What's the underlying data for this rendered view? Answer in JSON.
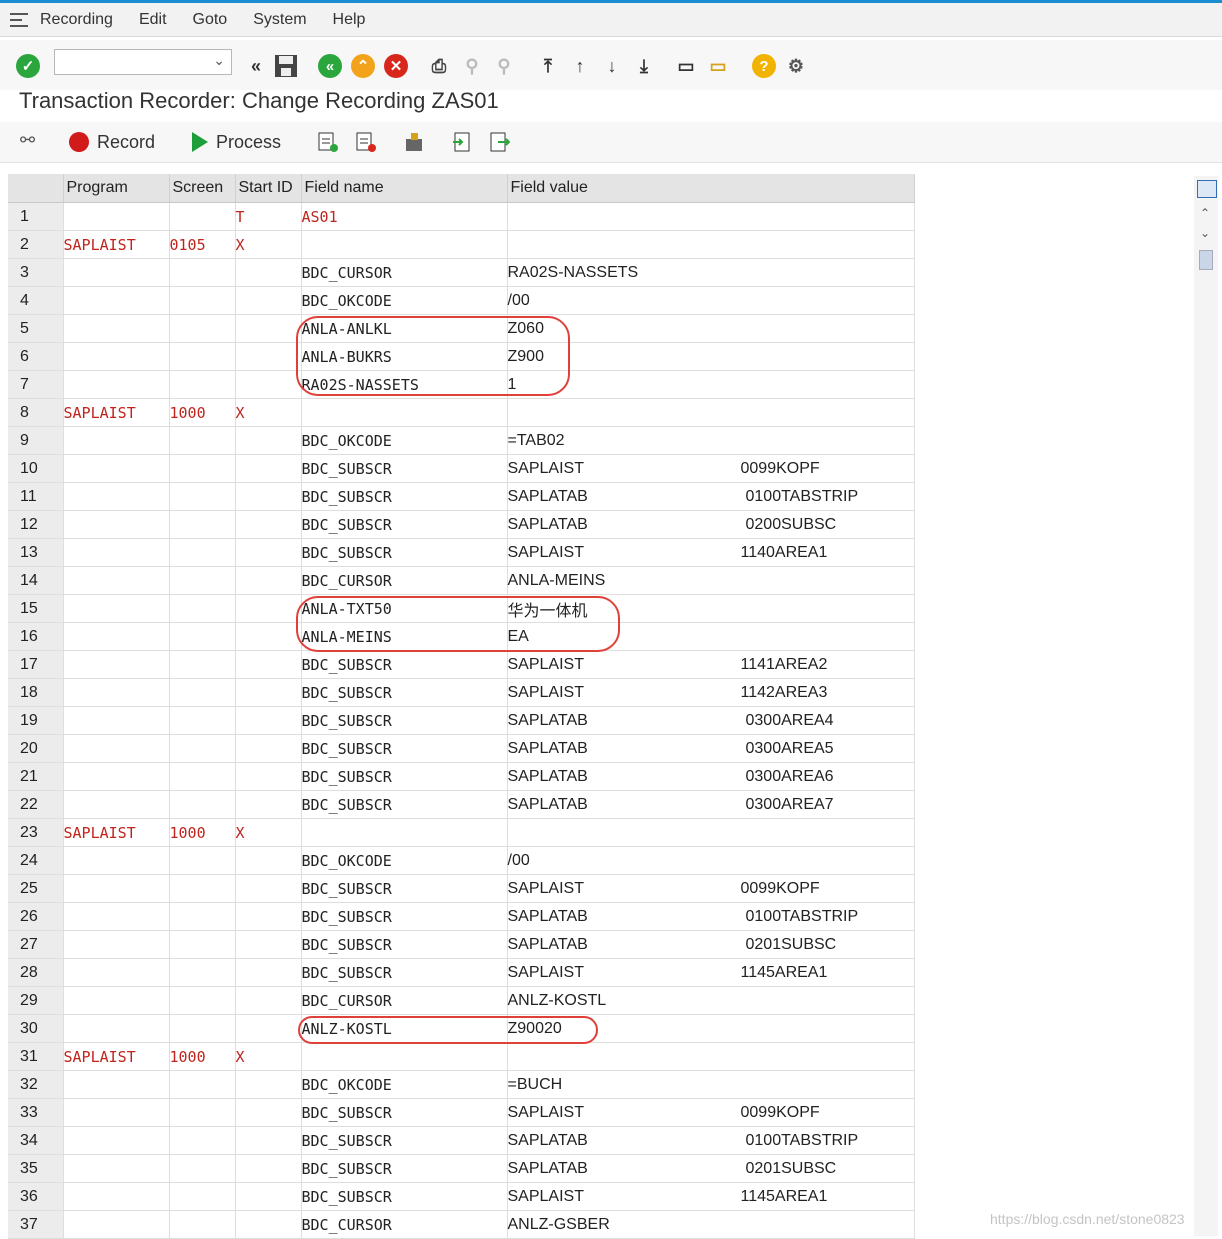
{
  "menu": [
    "Recording",
    "Edit",
    "Goto",
    "System",
    "Help"
  ],
  "page_title": "Transaction Recorder: Change Recording ZAS01",
  "app_toolbar": {
    "record_label": "Record",
    "process_label": "Process"
  },
  "columns": [
    "",
    "Program",
    "Screen",
    "Start ID",
    "Field name",
    "Field value"
  ],
  "rows": [
    {
      "n": "1",
      "program": "",
      "screen": "",
      "start": "T",
      "field": "AS01",
      "value": "",
      "extra": ""
    },
    {
      "n": "2",
      "program": "SAPLAIST",
      "screen": "0105",
      "start": "X",
      "field": "",
      "value": "",
      "extra": ""
    },
    {
      "n": "3",
      "program": "",
      "screen": "",
      "start": "",
      "field": "BDC_CURSOR",
      "value": "RA02S-NASSETS",
      "extra": ""
    },
    {
      "n": "4",
      "program": "",
      "screen": "",
      "start": "",
      "field": "BDC_OKCODE",
      "value": "/00",
      "extra": ""
    },
    {
      "n": "5",
      "program": "",
      "screen": "",
      "start": "",
      "field": "ANLA-ANLKL",
      "value": "Z060",
      "extra": ""
    },
    {
      "n": "6",
      "program": "",
      "screen": "",
      "start": "",
      "field": "ANLA-BUKRS",
      "value": "Z900",
      "extra": ""
    },
    {
      "n": "7",
      "program": "",
      "screen": "",
      "start": "",
      "field": "RA02S-NASSETS",
      "value": "1",
      "extra": ""
    },
    {
      "n": "8",
      "program": "SAPLAIST",
      "screen": "1000",
      "start": "X",
      "field": "",
      "value": "",
      "extra": ""
    },
    {
      "n": "9",
      "program": "",
      "screen": "",
      "start": "",
      "field": "BDC_OKCODE",
      "value": "=TAB02",
      "extra": ""
    },
    {
      "n": "10",
      "program": "",
      "screen": "",
      "start": "",
      "field": "BDC_SUBSCR",
      "value": "SAPLAIST",
      "extra": "0099KOPF"
    },
    {
      "n": "11",
      "program": "",
      "screen": "",
      "start": "",
      "field": "BDC_SUBSCR",
      "value": "SAPLATAB",
      "extra": "0100TABSTRIP"
    },
    {
      "n": "12",
      "program": "",
      "screen": "",
      "start": "",
      "field": "BDC_SUBSCR",
      "value": "SAPLATAB",
      "extra": "0200SUBSC"
    },
    {
      "n": "13",
      "program": "",
      "screen": "",
      "start": "",
      "field": "BDC_SUBSCR",
      "value": "SAPLAIST",
      "extra": "1140AREA1"
    },
    {
      "n": "14",
      "program": "",
      "screen": "",
      "start": "",
      "field": "BDC_CURSOR",
      "value": "ANLA-MEINS",
      "extra": ""
    },
    {
      "n": "15",
      "program": "",
      "screen": "",
      "start": "",
      "field": "ANLA-TXT50",
      "value": "华为一体机",
      "extra": ""
    },
    {
      "n": "16",
      "program": "",
      "screen": "",
      "start": "",
      "field": "ANLA-MEINS",
      "value": "EA",
      "extra": ""
    },
    {
      "n": "17",
      "program": "",
      "screen": "",
      "start": "",
      "field": "BDC_SUBSCR",
      "value": "SAPLAIST",
      "extra": "1141AREA2"
    },
    {
      "n": "18",
      "program": "",
      "screen": "",
      "start": "",
      "field": "BDC_SUBSCR",
      "value": "SAPLAIST",
      "extra": "1142AREA3"
    },
    {
      "n": "19",
      "program": "",
      "screen": "",
      "start": "",
      "field": "BDC_SUBSCR",
      "value": "SAPLATAB",
      "extra": "0300AREA4"
    },
    {
      "n": "20",
      "program": "",
      "screen": "",
      "start": "",
      "field": "BDC_SUBSCR",
      "value": "SAPLATAB",
      "extra": "0300AREA5"
    },
    {
      "n": "21",
      "program": "",
      "screen": "",
      "start": "",
      "field": "BDC_SUBSCR",
      "value": "SAPLATAB",
      "extra": "0300AREA6"
    },
    {
      "n": "22",
      "program": "",
      "screen": "",
      "start": "",
      "field": "BDC_SUBSCR",
      "value": "SAPLATAB",
      "extra": "0300AREA7"
    },
    {
      "n": "23",
      "program": "SAPLAIST",
      "screen": "1000",
      "start": "X",
      "field": "",
      "value": "",
      "extra": ""
    },
    {
      "n": "24",
      "program": "",
      "screen": "",
      "start": "",
      "field": "BDC_OKCODE",
      "value": "/00",
      "extra": ""
    },
    {
      "n": "25",
      "program": "",
      "screen": "",
      "start": "",
      "field": "BDC_SUBSCR",
      "value": "SAPLAIST",
      "extra": "0099KOPF"
    },
    {
      "n": "26",
      "program": "",
      "screen": "",
      "start": "",
      "field": "BDC_SUBSCR",
      "value": "SAPLATAB",
      "extra": "0100TABSTRIP"
    },
    {
      "n": "27",
      "program": "",
      "screen": "",
      "start": "",
      "field": "BDC_SUBSCR",
      "value": "SAPLATAB",
      "extra": "0201SUBSC"
    },
    {
      "n": "28",
      "program": "",
      "screen": "",
      "start": "",
      "field": "BDC_SUBSCR",
      "value": "SAPLAIST",
      "extra": "1145AREA1"
    },
    {
      "n": "29",
      "program": "",
      "screen": "",
      "start": "",
      "field": "BDC_CURSOR",
      "value": "ANLZ-KOSTL",
      "extra": ""
    },
    {
      "n": "30",
      "program": "",
      "screen": "",
      "start": "",
      "field": "ANLZ-KOSTL",
      "value": "Z90020",
      "extra": ""
    },
    {
      "n": "31",
      "program": "SAPLAIST",
      "screen": "1000",
      "start": "X",
      "field": "",
      "value": "",
      "extra": ""
    },
    {
      "n": "32",
      "program": "",
      "screen": "",
      "start": "",
      "field": "BDC_OKCODE",
      "value": "=BUCH",
      "extra": ""
    },
    {
      "n": "33",
      "program": "",
      "screen": "",
      "start": "",
      "field": "BDC_SUBSCR",
      "value": "SAPLAIST",
      "extra": "0099KOPF"
    },
    {
      "n": "34",
      "program": "",
      "screen": "",
      "start": "",
      "field": "BDC_SUBSCR",
      "value": "SAPLATAB",
      "extra": "0100TABSTRIP"
    },
    {
      "n": "35",
      "program": "",
      "screen": "",
      "start": "",
      "field": "BDC_SUBSCR",
      "value": "SAPLATAB",
      "extra": "0201SUBSC"
    },
    {
      "n": "36",
      "program": "",
      "screen": "",
      "start": "",
      "field": "BDC_SUBSCR",
      "value": "SAPLAIST",
      "extra": "1145AREA1"
    },
    {
      "n": "37",
      "program": "",
      "screen": "",
      "start": "",
      "field": "BDC_CURSOR",
      "value": "ANLZ-GSBER",
      "extra": ""
    }
  ],
  "colors": {
    "accent": "#1a8ed0",
    "program_text": "#c0241c",
    "highlight_ring": "#e0403a"
  },
  "watermark": "https://blog.csdn.net/stone0823"
}
